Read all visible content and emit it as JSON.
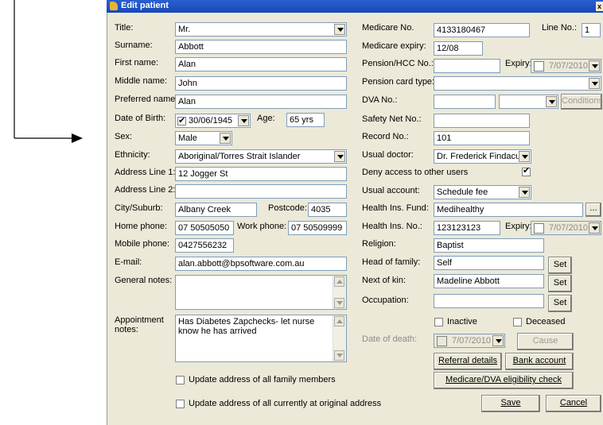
{
  "window": {
    "title": "Edit patient"
  },
  "fields": {
    "title": {
      "label": "Title:",
      "value": "Mr."
    },
    "surname": {
      "label": "Surname:",
      "value": "Abbott"
    },
    "first_name": {
      "label": "First name:",
      "value": "Alan"
    },
    "middle_name": {
      "label": "Middle name:",
      "value": "John"
    },
    "preferred_name": {
      "label": "Preferred name:",
      "value": "Alan"
    },
    "dob": {
      "label": "Date of Birth:",
      "value": "30/06/1945",
      "age_label": "Age:",
      "age_value": "65 yrs"
    },
    "sex": {
      "label": "Sex:",
      "value": "Male"
    },
    "ethnicity": {
      "label": "Ethnicity:",
      "value": "Aboriginal/Torres Strait Islander"
    },
    "address1": {
      "label": "Address Line 1:",
      "value": "12 Jogger St"
    },
    "address2": {
      "label": "Address Line 2:",
      "value": ""
    },
    "city": {
      "label": "City/Suburb:",
      "value": "Albany Creek",
      "postcode_label": "Postcode:",
      "postcode_value": "4035"
    },
    "home_phone": {
      "label": "Home phone:",
      "value": "07 50505050",
      "work_label": "Work phone:",
      "work_value": "07 50509999"
    },
    "mobile": {
      "label": "Mobile phone:",
      "value": "0427556232"
    },
    "email": {
      "label": "E-mail:",
      "value": "alan.abbott@bpsoftware.com.au"
    },
    "general_notes": {
      "label": "General notes:",
      "value": ""
    },
    "appointment_notes": {
      "label": "Appointment notes:",
      "value": "Has Diabetes Zapchecks- let nurse know he has arrived"
    },
    "medicare_no": {
      "label": "Medicare No.",
      "value": "4133180467",
      "line_label": "Line No.:",
      "line_value": "1"
    },
    "medicare_expiry": {
      "label": "Medicare expiry:",
      "value": "12/08"
    },
    "pension": {
      "label": "Pension/HCC No.:",
      "value": "",
      "expiry_label": "Expiry:",
      "expiry_value": "7/07/2010"
    },
    "pension_type": {
      "label": "Pension card type:",
      "value": ""
    },
    "dva": {
      "label": "DVA No.:",
      "value": "",
      "type_value": "",
      "conditions_button": "Conditions"
    },
    "safety_net": {
      "label": "Safety Net No.:",
      "value": ""
    },
    "record_no": {
      "label": "Record No.:",
      "value": "101"
    },
    "usual_doctor": {
      "label": "Usual doctor:",
      "value": "Dr. Frederick Findacure"
    },
    "deny_access": {
      "label": "Deny access to other users",
      "checked": true
    },
    "usual_account": {
      "label": "Usual account:",
      "value": "Schedule fee"
    },
    "health_fund": {
      "label": "Health Ins. Fund:",
      "value": "Medihealthy",
      "browse": "..."
    },
    "health_no": {
      "label": "Health Ins. No.:",
      "value": "123123123",
      "expiry_label": "Expiry:",
      "expiry_value": "7/07/2010"
    },
    "religion": {
      "label": "Religion:",
      "value": "Baptist"
    },
    "head_of_family": {
      "label": "Head of family:",
      "value": "Self",
      "button": "Set"
    },
    "next_of_kin": {
      "label": "Next of kin:",
      "value": "Madeline Abbott",
      "button": "Set"
    },
    "occupation": {
      "label": "Occupation:",
      "value": "",
      "button": "Set"
    },
    "inactive": {
      "label": "Inactive",
      "checked": false
    },
    "deceased": {
      "label": "Deceased",
      "checked": false
    },
    "date_of_death": {
      "label": "Date of death:",
      "value": "7/07/2010",
      "cause_button": "Cause"
    }
  },
  "buttons": {
    "referral": "Referral details",
    "bank": "Bank account",
    "eligibility": "Medicare/DVA eligibility check",
    "save": "Save",
    "cancel": "Cancel"
  },
  "checkboxes": {
    "update_family": "Update address of all family members",
    "update_all": "Update address of all currently at original address"
  }
}
